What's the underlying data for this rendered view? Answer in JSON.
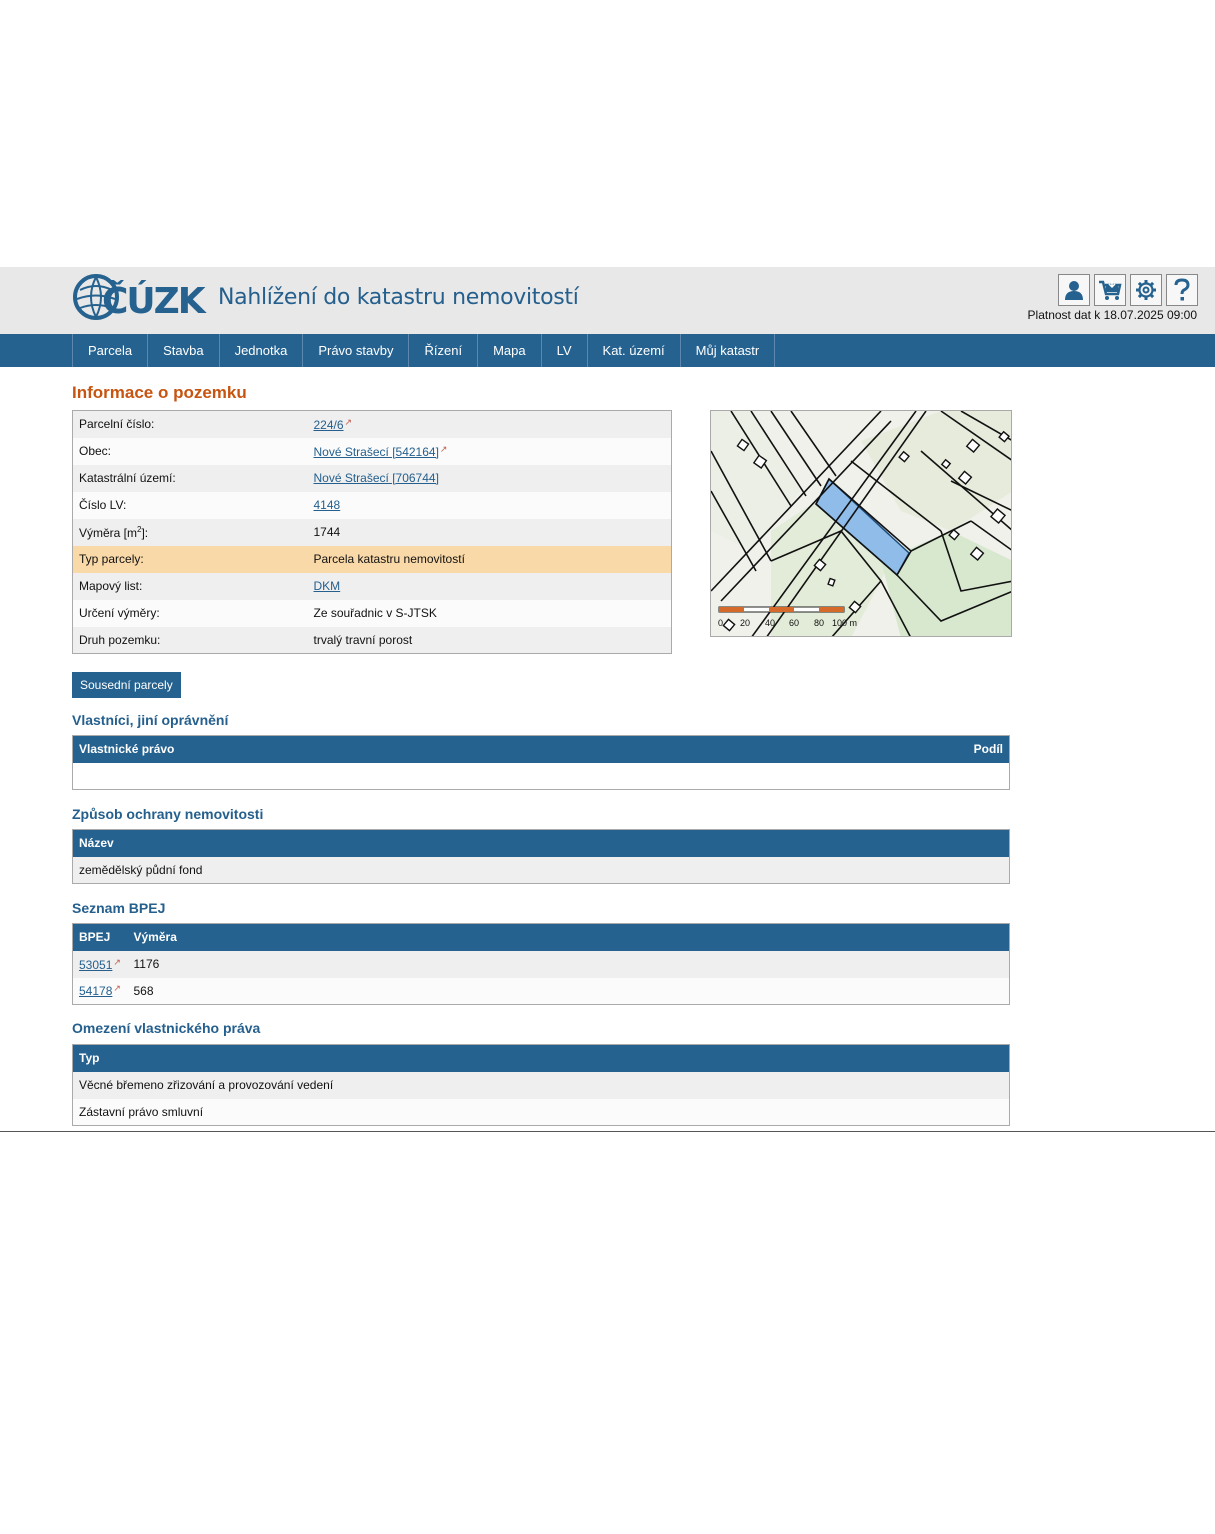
{
  "header": {
    "logo_text": "ČÚZK",
    "app_title": "Nahlížení do katastru nemovitostí",
    "validity": "Platnost dat k 18.07.2025 09:00",
    "icons": [
      "user-icon",
      "cart-icon",
      "gear-icon",
      "help-icon"
    ]
  },
  "nav": {
    "items": [
      "Parcela",
      "Stavba",
      "Jednotka",
      "Právo stavby",
      "Řízení",
      "Mapa",
      "LV",
      "Kat. území",
      "Můj katastr"
    ]
  },
  "parcel": {
    "title": "Informace o pozemku",
    "rows": [
      {
        "label": "Parcelní číslo:",
        "value": "224/6"
      },
      {
        "label": "Obec:",
        "value": "Nové Strašecí [542164]"
      },
      {
        "label": "Katastrální území:",
        "value": "Nové Strašecí [706744]"
      },
      {
        "label": "Číslo LV:",
        "value": "4148"
      },
      {
        "label": "Výměra [m",
        "sup": "2",
        "label_end": "]:",
        "value": "1744"
      },
      {
        "label": "Typ parcely:",
        "value": "Parcela katastru nemovitostí"
      },
      {
        "label": "Mapový list:",
        "value": "DKM"
      },
      {
        "label": "Určení výměry:",
        "value": "Ze souřadnic v S-JTSK"
      },
      {
        "label": "Druh pozemku:",
        "value": "trvalý travní porost"
      }
    ],
    "neighbors_button": "Sousední parcely"
  },
  "map": {
    "scale_labels": [
      "0",
      "20",
      "40",
      "60",
      "80",
      "100 m"
    ],
    "highlight_color": "#8fbce8"
  },
  "owners": {
    "title": "Vlastníci, jiní oprávnění",
    "col_left": "Vlastnické právo",
    "col_right": "Podíl"
  },
  "protection": {
    "title": "Způsob ochrany nemovitosti",
    "header": "Název",
    "rows": [
      "zemědělský půdní fond"
    ]
  },
  "bpej": {
    "title": "Seznam BPEJ",
    "headers": [
      "BPEJ",
      "Výměra"
    ],
    "rows": [
      {
        "code": "53051",
        "area": "1176"
      },
      {
        "code": "54178",
        "area": "568"
      }
    ]
  },
  "restrictions": {
    "title": "Omezení vlastnického práva",
    "header": "Typ",
    "rows": [
      "Věcné břemeno zřizování a provozování vedení",
      "Zástavní právo smluvní"
    ]
  },
  "colors": {
    "brand_blue": "#25628f",
    "accent_orange": "#c75410",
    "highlight_row": "#fad9a8"
  }
}
